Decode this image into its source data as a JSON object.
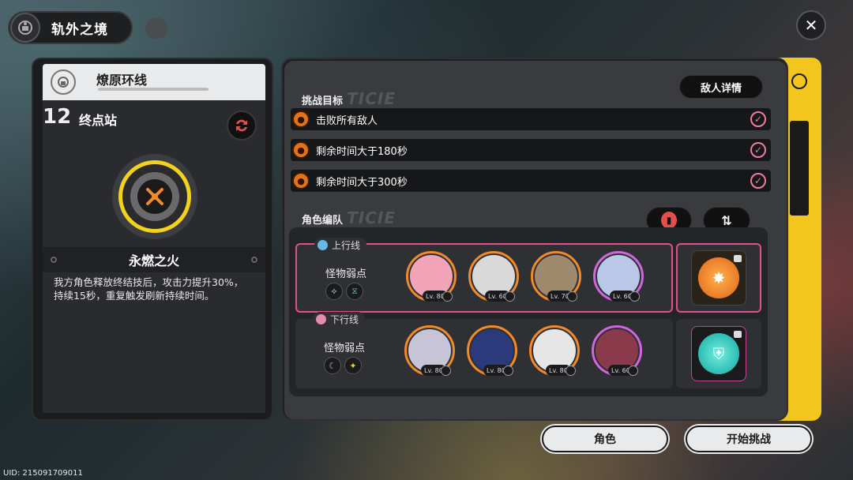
{
  "header": {
    "title": "轨外之境"
  },
  "left": {
    "route_name": "燎原环线",
    "stage_number": "12",
    "stage_name": "终点站",
    "buff_title": "永燃之火",
    "buff_desc": "我方角色释放终结技后，攻击力提升30%，持续15秒，重复触发刷新持续时间。"
  },
  "objectives": {
    "label": "挑战目标",
    "ghost": "TICIE",
    "enemy_details": "敌人详情",
    "items": [
      {
        "text": "击败所有敌人",
        "done": true
      },
      {
        "text": "剩余时间大于180秒",
        "done": true
      },
      {
        "text": "剩余时间大于300秒",
        "done": true
      }
    ]
  },
  "team": {
    "label": "角色编队",
    "ghost": "TICIE",
    "lanes": [
      {
        "name": "上行线",
        "weak_label": "怪物弱点",
        "weak_icons": [
          "✧",
          "⧖"
        ],
        "chars": [
          {
            "lv": "Lv. 80",
            "frame": "orange",
            "color": "#f2a4b8"
          },
          {
            "lv": "Lv. 60",
            "frame": "orange",
            "color": "#d9d9d9"
          },
          {
            "lv": "Lv. 70",
            "frame": "orange",
            "color": "#a08a6e"
          },
          {
            "lv": "Lv. 60",
            "frame": "purple",
            "color": "#b8c8e6"
          }
        ]
      },
      {
        "name": "下行线",
        "weak_label": "怪物弱点",
        "weak_icons": [
          "☾",
          "✦"
        ],
        "chars": [
          {
            "lv": "Lv. 80",
            "frame": "orange",
            "color": "#c8c4d8"
          },
          {
            "lv": "Lv. 80",
            "frame": "orange",
            "color": "#2a3a7a"
          },
          {
            "lv": "Lv. 80",
            "frame": "orange",
            "color": "#e6e6e6"
          },
          {
            "lv": "Lv. 60",
            "frame": "purple",
            "color": "#8a3a4a"
          }
        ]
      }
    ]
  },
  "buttons": {
    "characters": "角色",
    "start": "开始挑战"
  },
  "uid": "UID: 215091709011",
  "close_glyph": "✕",
  "colors": {
    "accent_yellow": "#f3c61e",
    "accent_pink": "#e2508c",
    "accent_orange": "#e0731b"
  }
}
